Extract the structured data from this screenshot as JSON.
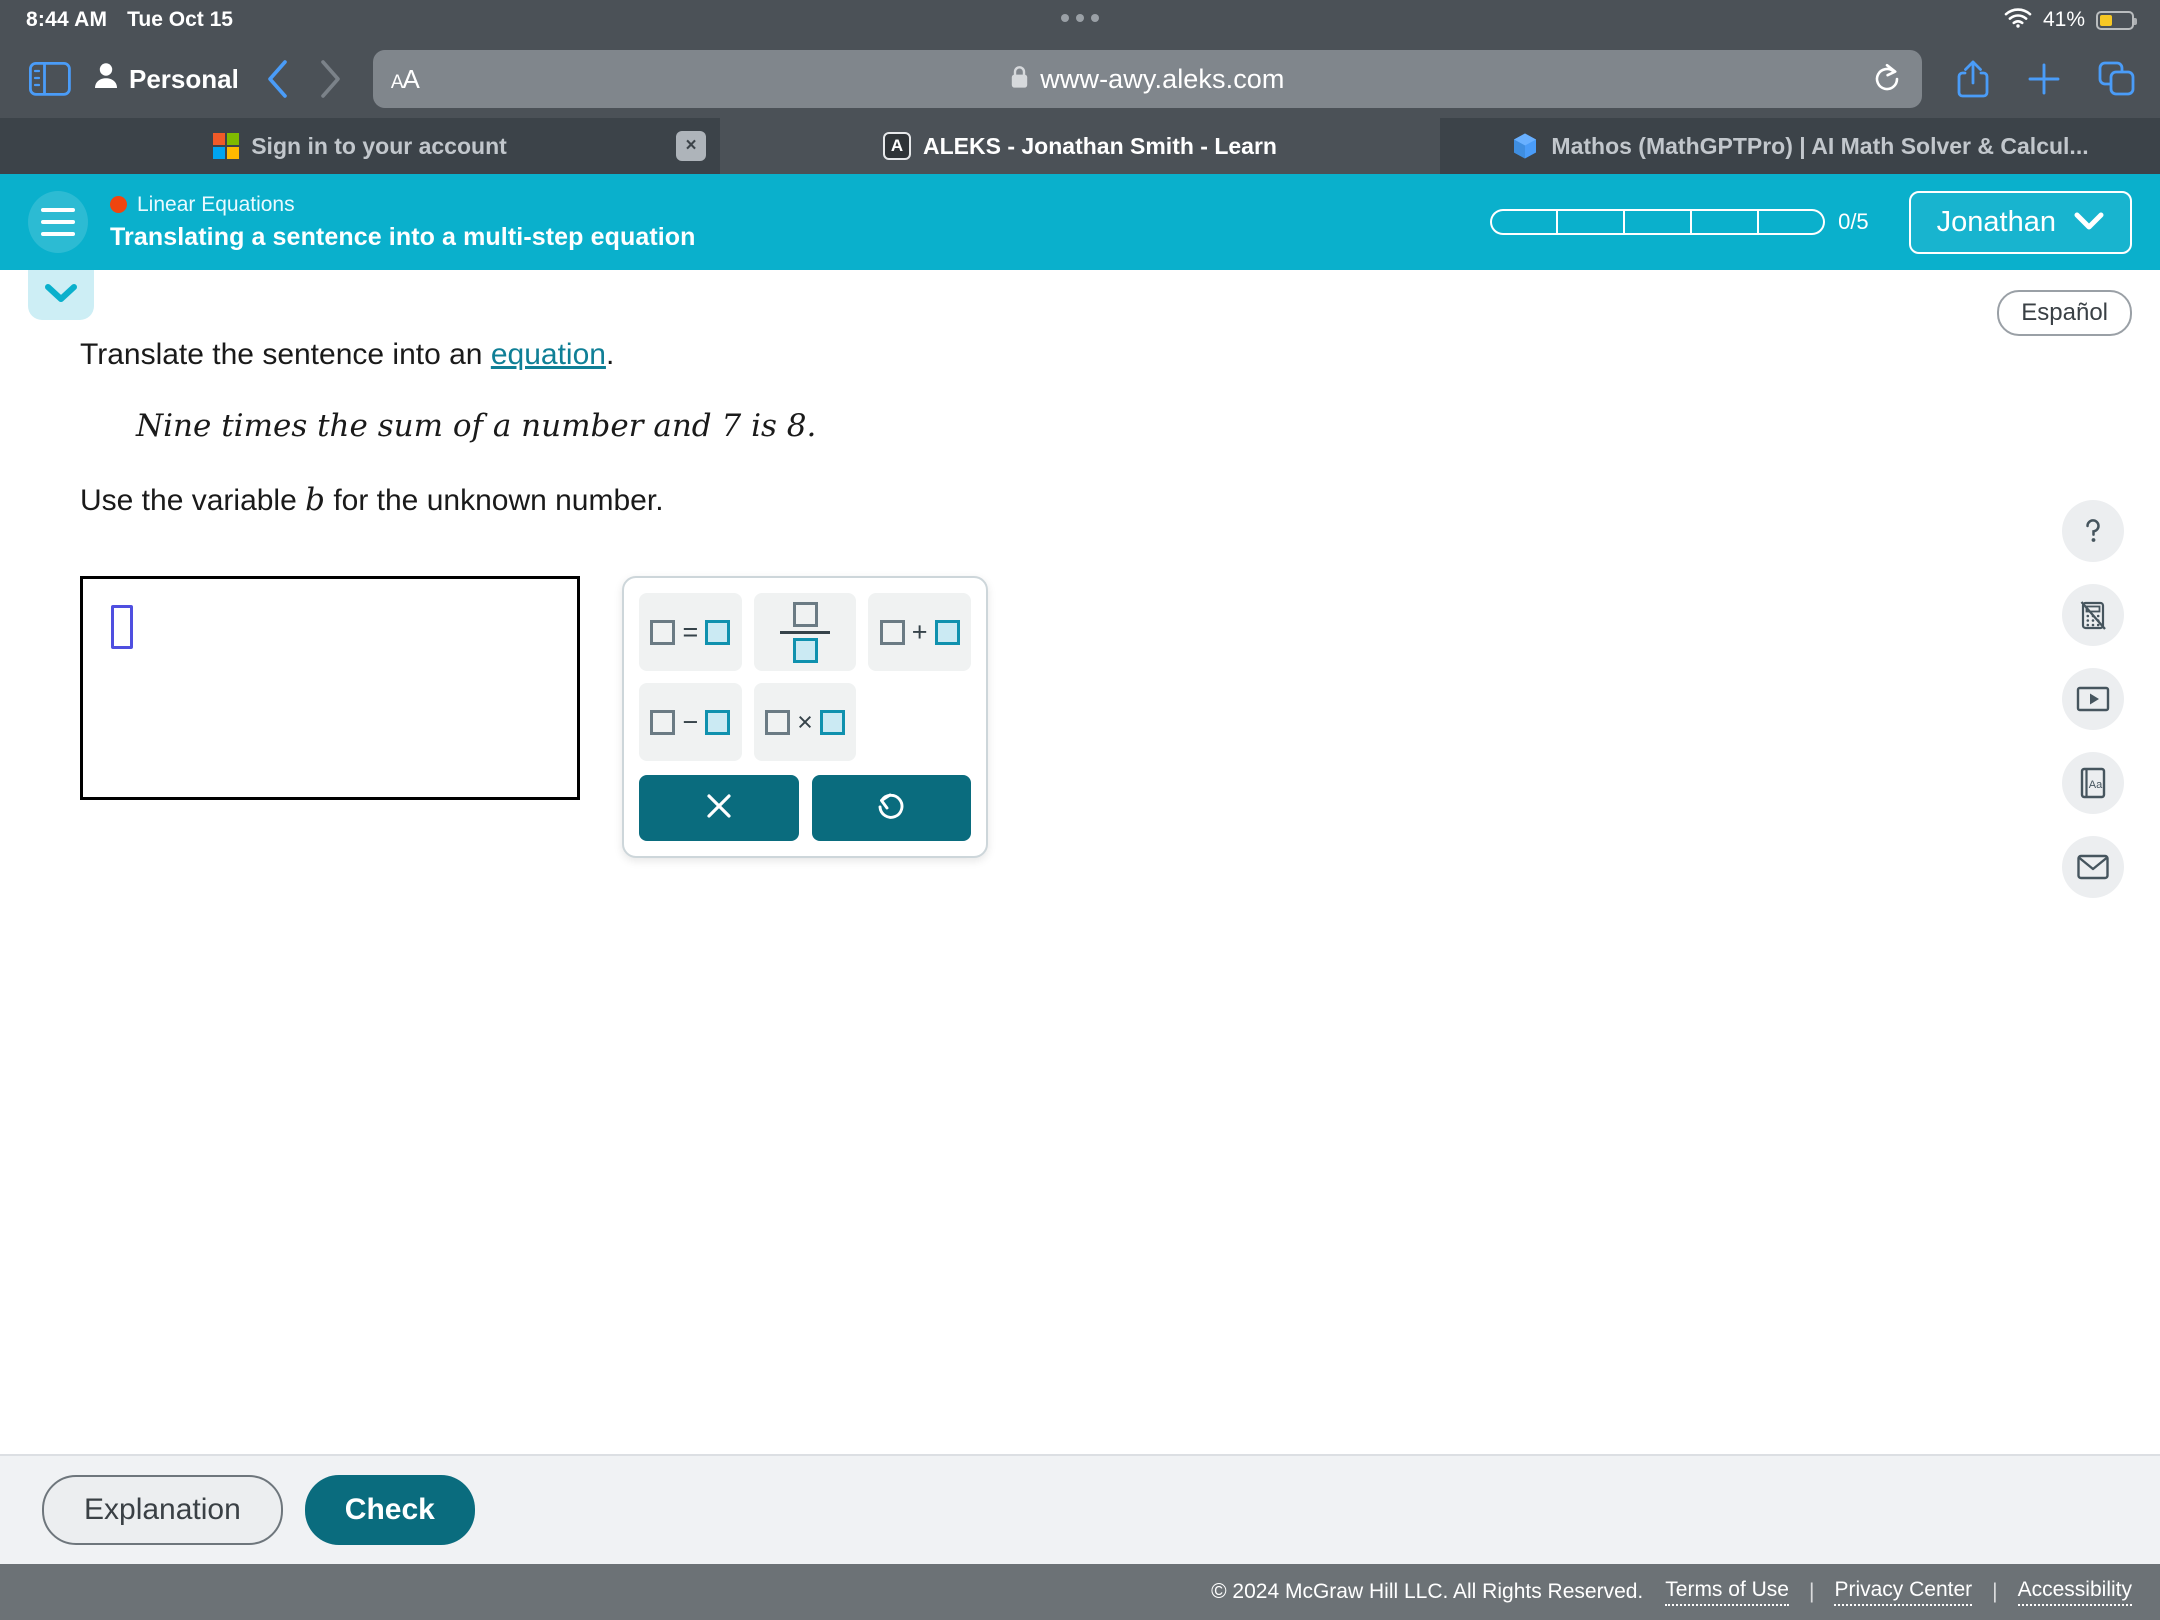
{
  "status_bar": {
    "time": "8:44 AM",
    "date": "Tue Oct 15",
    "battery_percent": "41%",
    "wifi_icon": "wifi-icon",
    "battery_icon": "battery-low-power-icon"
  },
  "browser": {
    "sidebar_icon": "sidebar-toggle-icon",
    "profile_label": "Personal",
    "profile_icon": "person-icon",
    "back_icon": "chevron-left-icon",
    "forward_icon": "chevron-right-icon",
    "text_size_label": "AA",
    "lock_icon": "lock-icon",
    "url": "www-awy.aleks.com",
    "reload_icon": "reload-icon",
    "share_icon": "share-icon",
    "new_tab_icon": "plus-icon",
    "tabs_overview_icon": "tab-overview-icon",
    "tabs": [
      {
        "label": "Sign in to your account",
        "favicon": "microsoft-logo-icon",
        "active": false,
        "close_label": "×"
      },
      {
        "label": "ALEKS - Jonathan Smith - Learn",
        "favicon": "aleks-a-icon",
        "active": true
      },
      {
        "label": "Mathos (MathGPTPro) | AI Math Solver & Calcul...",
        "favicon": "mathos-cube-icon",
        "active": false
      }
    ]
  },
  "aleks_header": {
    "menu_icon": "hamburger-menu-icon",
    "topic_dot_color": "#f0450f",
    "topic": "Linear Equations",
    "title": "Translating a sentence into a multi-step equation",
    "progress_segments": 5,
    "progress_label": "0/5",
    "user_name": "Jonathan",
    "user_chevron_icon": "chevron-down-icon",
    "accent_color": "#0ab0cc"
  },
  "content": {
    "collapse_icon": "chevron-down-icon",
    "language_button": "Español",
    "prompt_prefix": "Translate the sentence into an ",
    "prompt_link": "equation",
    "prompt_suffix": ".",
    "sentence_a": "Nine times the sum of a number and ",
    "sentence_number": "7",
    "sentence_b": " is ",
    "sentence_end": "8.",
    "variable_prefix": "Use the variable ",
    "variable": "b",
    "variable_suffix": " for the unknown number.",
    "answer_placeholder": "empty-answer-box",
    "palette": {
      "keys": [
        {
          "name": "equals-template",
          "type": "binary",
          "op": "="
        },
        {
          "name": "fraction-template",
          "type": "fraction"
        },
        {
          "name": "plus-template",
          "type": "binary",
          "op": "+"
        },
        {
          "name": "minus-template",
          "type": "binary",
          "op": "−"
        },
        {
          "name": "multiply-template",
          "type": "binary",
          "op": "×"
        }
      ],
      "clear_icon": "close-x-icon",
      "undo_icon": "undo-icon"
    },
    "tools": [
      {
        "name": "help-icon",
        "label": "?"
      },
      {
        "name": "calculator-disabled-icon",
        "label": "calculator off"
      },
      {
        "name": "video-play-icon",
        "label": "video"
      },
      {
        "name": "dictionary-icon",
        "label": "Aa"
      },
      {
        "name": "mail-icon",
        "label": "mail"
      }
    ]
  },
  "footer": {
    "explanation_label": "Explanation",
    "check_label": "Check",
    "copyright": "© 2024 McGraw Hill LLC. All Rights Reserved.",
    "links": [
      "Terms of Use",
      "Privacy Center",
      "Accessibility"
    ],
    "separator": "|"
  }
}
